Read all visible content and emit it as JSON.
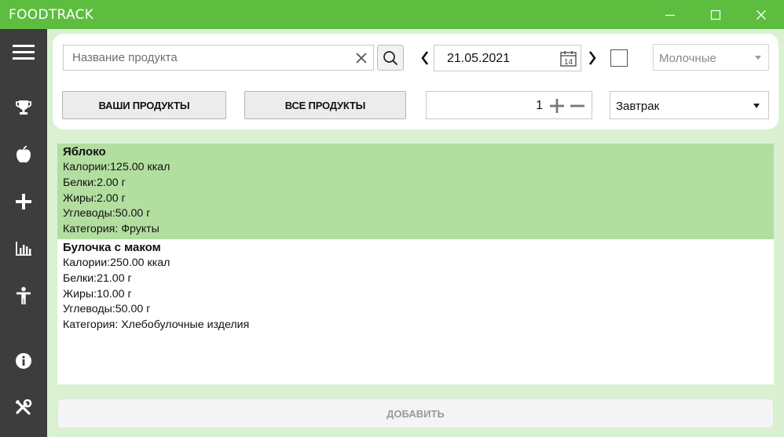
{
  "app": {
    "title": "FOODTRACK"
  },
  "window": {
    "minimize_label": "minimize",
    "maximize_label": "maximize",
    "close_label": "close"
  },
  "sidebar": {
    "items": [
      {
        "icon": "menu-icon"
      },
      {
        "icon": "trophy-icon"
      },
      {
        "icon": "apple-icon"
      },
      {
        "icon": "plus-icon"
      },
      {
        "icon": "bar-chart-icon"
      },
      {
        "icon": "person-icon"
      },
      {
        "icon": "info-icon"
      },
      {
        "icon": "tools-icon"
      }
    ]
  },
  "search": {
    "placeholder": "Название продукта",
    "value": ""
  },
  "date": {
    "value": "21.05.2021",
    "calendar_day": "14"
  },
  "category": {
    "selected": "Молочные"
  },
  "buttons": {
    "your_products": "ВАШИ ПРОДУКТЫ",
    "all_products": "ВСЕ ПРОДУКТЫ",
    "add": "ДОБАВИТЬ"
  },
  "quantity": {
    "value": "1"
  },
  "meal": {
    "selected": "Завтрак"
  },
  "products": [
    {
      "name": "Яблоко",
      "selected": true,
      "lines": [
        "Калории:125.00 ккал",
        "Белки:2.00 г",
        "Жиры:2.00 г",
        "Углеводы:50.00 г",
        "Категория: Фрукты"
      ]
    },
    {
      "name": "Булочка с маком",
      "selected": false,
      "lines": [
        "Калории:250.00 ккал",
        "Белки:21.00 г",
        "Жиры:10.00 г",
        "Углеводы:50.00 г",
        "Категория: Хлебобулочные изделия"
      ]
    }
  ],
  "colors": {
    "accent": "#5cbd3f",
    "sidebar": "#3d3d3d",
    "content_bg": "#d9f1d0",
    "selected_row": "#b2dea0"
  }
}
